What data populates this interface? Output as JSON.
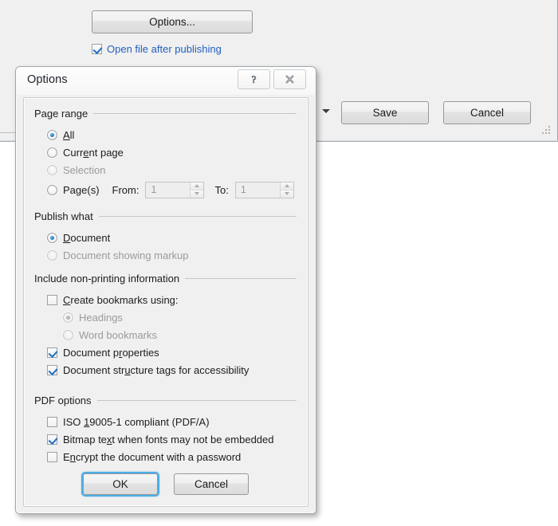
{
  "background_window": {
    "options_button_label": "Options...",
    "open_after_publishing": {
      "label": "Open file after publishing",
      "checked": true
    },
    "save_button_label": "Save",
    "cancel_button_label": "Cancel"
  },
  "dialog": {
    "title": "Options",
    "caption_buttons": {
      "help": "?",
      "close": "✕"
    },
    "groups": {
      "page_range": {
        "title": "Page range",
        "options": [
          {
            "label_pre": "",
            "label_accel": "A",
            "label_post": "ll",
            "checked": true,
            "disabled": false
          },
          {
            "label_pre": "Curr",
            "label_accel": "e",
            "label_post": "nt page",
            "checked": false,
            "disabled": false
          },
          {
            "label_pre": "Selection",
            "label_accel": "",
            "label_post": "",
            "checked": false,
            "disabled": true
          },
          {
            "label_pre": "Pa",
            "label_accel": "g",
            "label_post": "e(s)",
            "checked": false,
            "disabled": false
          }
        ],
        "from_label": "From:",
        "from_value": "1",
        "to_label": "To:",
        "to_value": "1"
      },
      "publish_what": {
        "title": "Publish what",
        "options": [
          {
            "label_pre": "",
            "label_accel": "D",
            "label_post": "ocument",
            "checked": true,
            "disabled": false
          },
          {
            "label_pre": "Document showing markup",
            "label_accel": "",
            "label_post": "",
            "checked": false,
            "disabled": true
          }
        ]
      },
      "include_non_printing": {
        "title": "Include non-printing information",
        "create_bookmarks": {
          "label_pre": "",
          "label_accel": "C",
          "label_post": "reate bookmarks using:",
          "checked": false,
          "disabled": false
        },
        "bookmark_sources": [
          {
            "label_pre": "Headings",
            "label_accel": "",
            "label_post": "",
            "checked": true,
            "disabled": true
          },
          {
            "label_pre": "Word bookmarks",
            "label_accel": "",
            "label_post": "",
            "checked": false,
            "disabled": true
          }
        ],
        "checkboxes": [
          {
            "label_pre": "Document p",
            "label_accel": "r",
            "label_post": "operties",
            "checked": true,
            "disabled": false
          },
          {
            "label_pre": "Document str",
            "label_accel": "u",
            "label_post": "cture tags for accessibility",
            "checked": true,
            "disabled": false
          }
        ]
      },
      "pdf_options": {
        "title": "PDF options",
        "checkboxes": [
          {
            "label_pre": "ISO ",
            "label_accel": "1",
            "label_post": "9005-1 compliant (PDF/A)",
            "checked": false,
            "disabled": false
          },
          {
            "label_pre": "Bitmap te",
            "label_accel": "x",
            "label_post": "t when fonts may not be embedded",
            "checked": true,
            "disabled": false
          },
          {
            "label_pre": "E",
            "label_accel": "n",
            "label_post": "crypt the document with a password",
            "checked": false,
            "disabled": false
          }
        ]
      }
    },
    "footer": {
      "ok_label": "OK",
      "cancel_label": "Cancel"
    }
  },
  "colors": {
    "accent_blue": "#1c6fc0",
    "link_blue": "#1f5fbf",
    "focus_ring": "#4aaee8",
    "dialog_bg": "#f0f0f0",
    "disabled_text": "#9b9b9b"
  }
}
